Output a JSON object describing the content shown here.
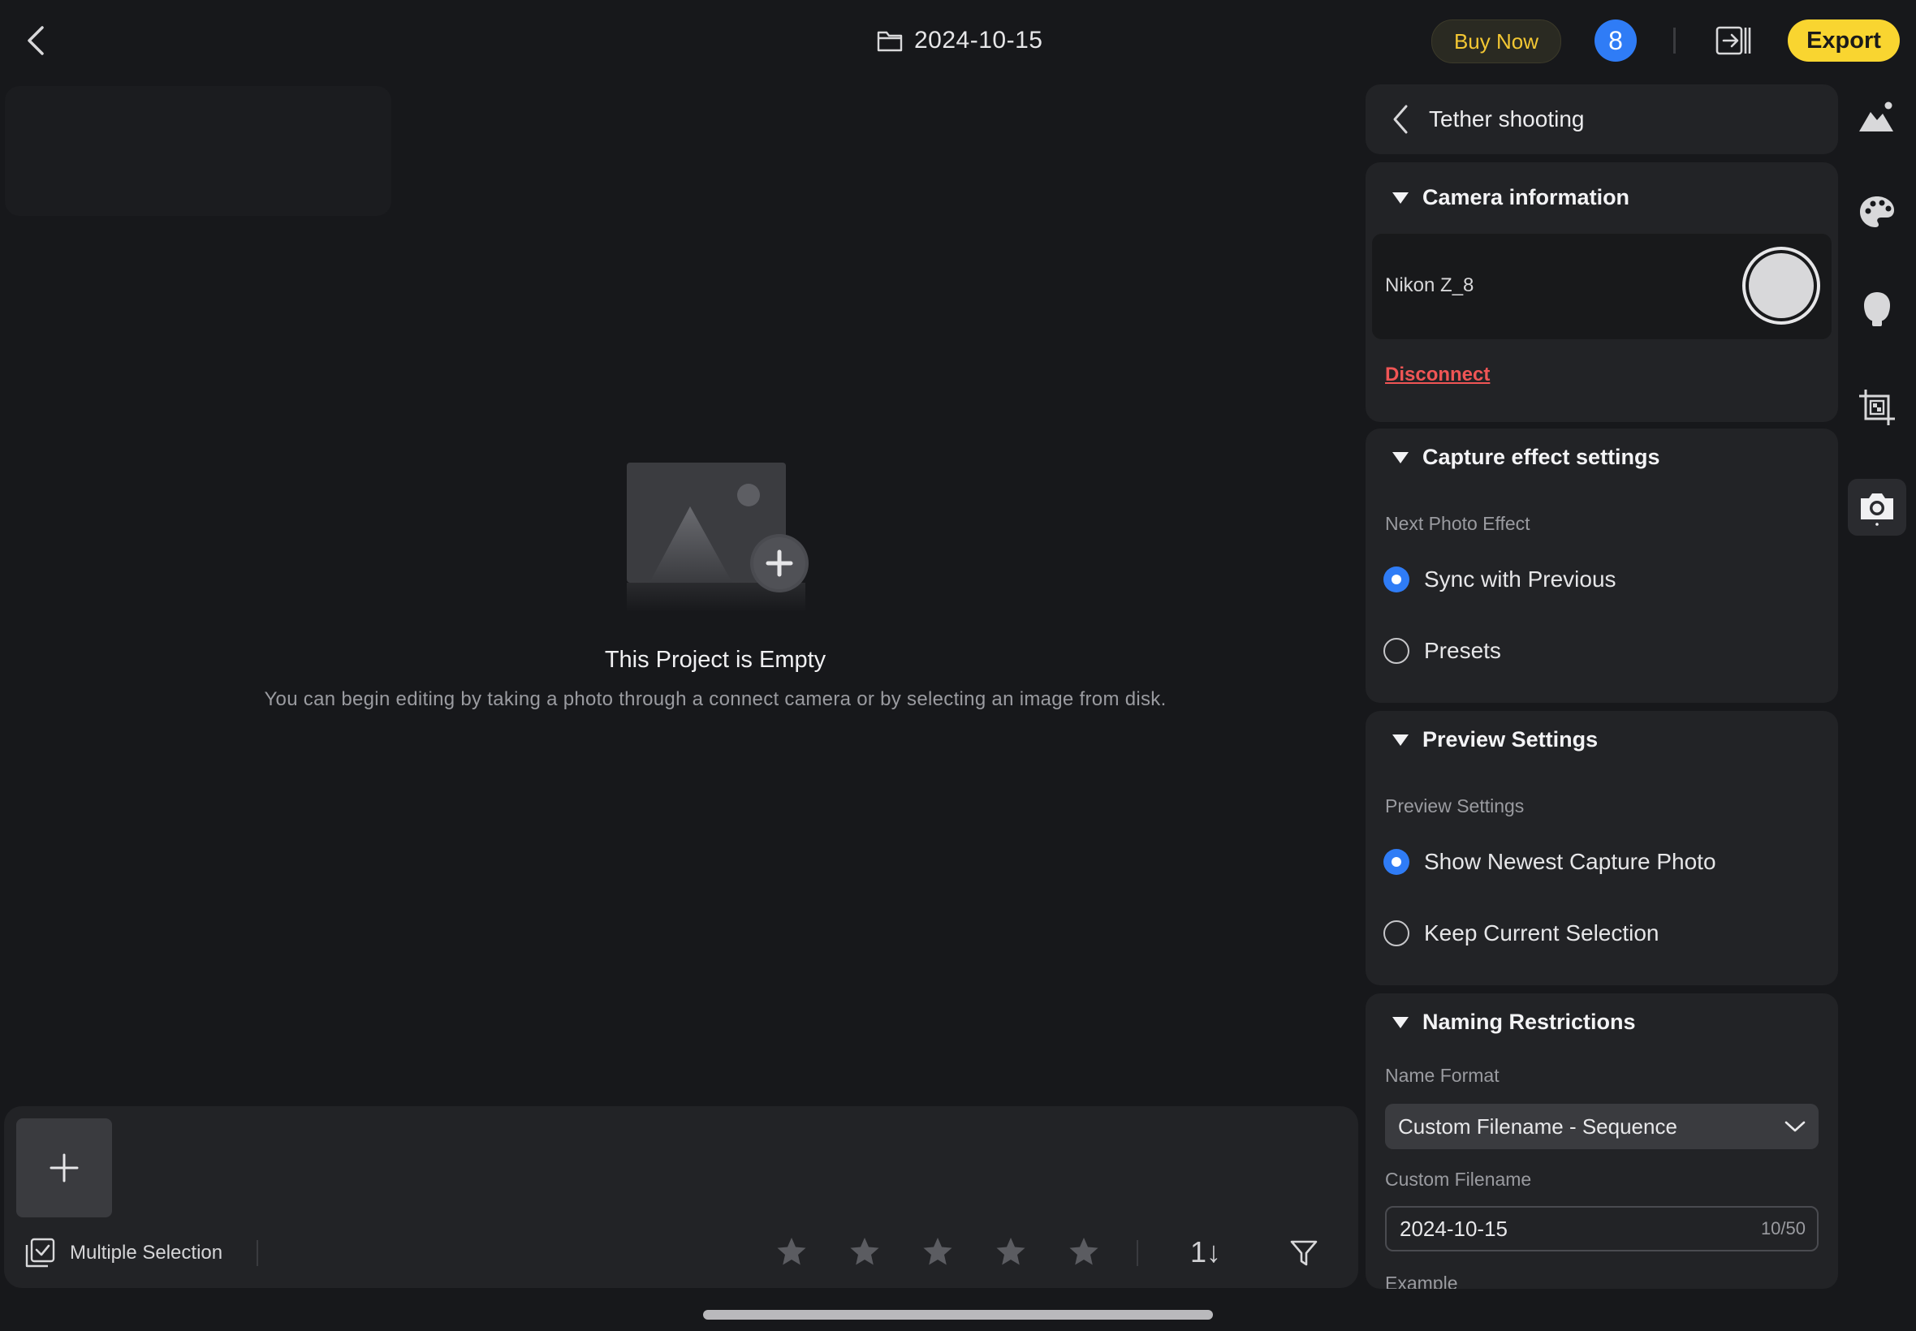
{
  "header": {
    "title": "2024-10-15",
    "buy_label": "Buy Now",
    "badge_count": "8",
    "export_label": "Export"
  },
  "empty_state": {
    "title": "This Project is Empty",
    "description": "You can begin editing by taking a photo through a connect camera or by selecting an image from disk."
  },
  "bottom_bar": {
    "multi_select_label": "Multiple Selection",
    "sort_label": "1↓",
    "star_count": 5
  },
  "panel": {
    "title": "Tether shooting",
    "camera": {
      "section_title": "Camera information",
      "camera_name": "Nikon Z_8",
      "disconnect_label": "Disconnect"
    },
    "capture": {
      "section_title": "Capture effect settings",
      "sub_label": "Next Photo Effect",
      "options": [
        "Sync with Previous",
        "Presets"
      ],
      "selected": "Sync with Previous"
    },
    "preview": {
      "section_title": "Preview Settings",
      "sub_label": "Preview Settings",
      "options": [
        "Show Newest Capture Photo",
        "Keep Current Selection"
      ],
      "selected": "Show Newest Capture Photo"
    },
    "naming": {
      "section_title": "Naming Restrictions",
      "name_format_label": "Name Format",
      "name_format_value": "Custom Filename - Sequence",
      "custom_filename_label": "Custom Filename",
      "custom_filename_value": "2024-10-15",
      "char_counter": "10/50",
      "example_label": "Example"
    }
  },
  "rail_icons": [
    "landscape-icon",
    "palette-icon",
    "portrait-icon",
    "crop-icon",
    "camera-icon"
  ],
  "colors": {
    "accent_blue": "#2f7cf6",
    "export_yellow": "#f9d530",
    "buy_text": "#f3c733",
    "disconnect_red": "#f05555",
    "background": "#17181b",
    "panel": "#222326"
  }
}
